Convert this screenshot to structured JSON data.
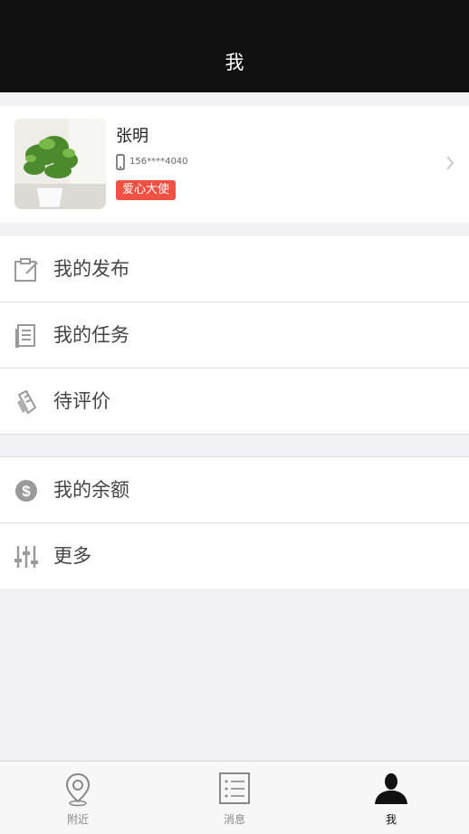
{
  "header": {
    "title": "我"
  },
  "profile": {
    "name": "张明",
    "phone": "156****4040",
    "badge": "爱心大使",
    "badge_color": "#f05142"
  },
  "menu_groups": [
    {
      "items": [
        {
          "label": "我的发布",
          "icon": "edit-icon"
        },
        {
          "label": "我的任务",
          "icon": "task-list-icon"
        },
        {
          "label": "待评价",
          "icon": "review-tag-icon"
        }
      ]
    },
    {
      "items": [
        {
          "label": "我的余额",
          "icon": "dollar-coin-icon"
        },
        {
          "label": "更多",
          "icon": "sliders-icon"
        }
      ]
    }
  ],
  "tabbar": {
    "tabs": [
      {
        "label": "附近",
        "icon": "location-pin-icon",
        "active": false
      },
      {
        "label": "消息",
        "icon": "message-list-icon",
        "active": false
      },
      {
        "label": "我",
        "icon": "user-silhouette-icon",
        "active": true
      }
    ]
  },
  "colors": {
    "header_bg": "#111111",
    "accent_red": "#f05142",
    "page_bg": "#f2f2f4"
  }
}
